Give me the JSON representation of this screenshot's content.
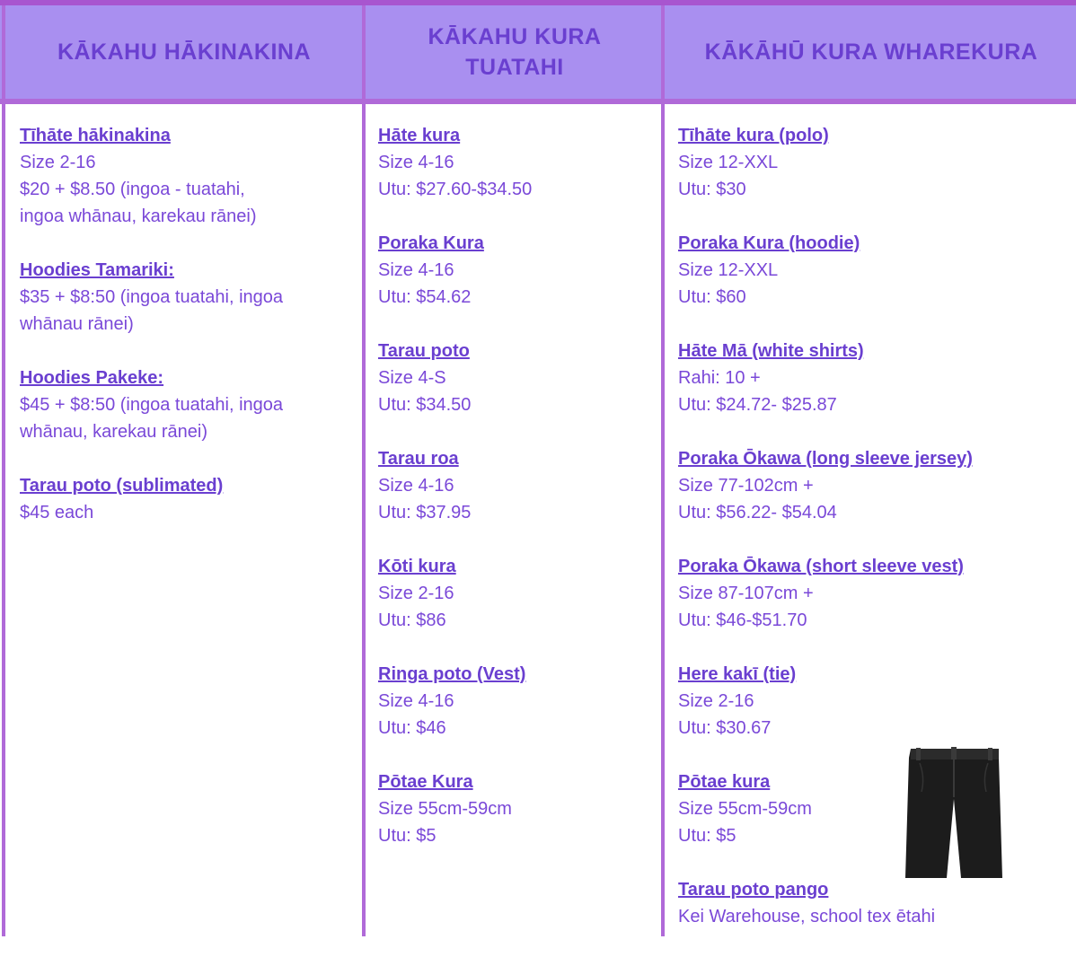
{
  "headers": [
    "KĀKAHU HĀKINAKINA",
    "KĀKAHU KURA TUATAHI",
    "KĀKĀHŪ KURA WHAREKURA"
  ],
  "columns": [
    {
      "items": [
        {
          "title": "Tīhāte hākinakina",
          "lines": [
            "Size 2-16",
            "$20 + $8.50 (ingoa - tuatahi,",
            "ingoa whānau, karekau rānei)"
          ]
        },
        {
          "title": "Hoodies Tamariki:",
          "lines": [
            "$35 + $8:50 (ingoa tuatahi, ingoa",
            "whānau rānei)"
          ]
        },
        {
          "title": "Hoodies Pakeke:",
          "lines": [
            "$45 + $8:50 (ingoa tuatahi, ingoa",
            "whānau, karekau rānei)"
          ]
        },
        {
          "title": "Tarau poto (sublimated)",
          "lines": [
            "$45 each"
          ]
        }
      ]
    },
    {
      "items": [
        {
          "title": "Hāte kura",
          "lines": [
            "Size 4-16",
            "Utu: $27.60-$34.50"
          ]
        },
        {
          "title": "Poraka Kura",
          "lines": [
            "Size 4-16",
            "Utu: $54.62"
          ]
        },
        {
          "title": "Tarau poto",
          "lines": [
            "Size 4-S",
            "Utu: $34.50"
          ]
        },
        {
          "title": "Tarau roa",
          "lines": [
            "Size 4-16",
            "Utu: $37.95"
          ]
        },
        {
          "title": "Kōti kura",
          "lines": [
            "Size 2-16",
            "Utu: $86"
          ]
        },
        {
          "title": "Ringa poto (Vest)",
          "lines": [
            "Size 4-16",
            "Utu: $46"
          ]
        },
        {
          "title": "Pōtae Kura",
          "lines": [
            "Size 55cm-59cm",
            "Utu: $5"
          ]
        }
      ]
    },
    {
      "items": [
        {
          "title": "Tīhāte kura (polo)",
          "lines": [
            "Size 12-XXL",
            "Utu: $30"
          ]
        },
        {
          "title": "Poraka Kura (hoodie)",
          "lines": [
            "Size 12-XXL",
            "Utu: $60"
          ]
        },
        {
          "title": "Hāte Mā (white shirts)",
          "lines": [
            "Rahi: 10 +",
            "Utu: $24.72- $25.87"
          ]
        },
        {
          "title": "Poraka Ōkawa (long sleeve jersey)",
          "lines": [
            "Size 77-102cm +",
            "Utu: $56.22- $54.04"
          ]
        },
        {
          "title": "Poraka Ōkawa (short sleeve vest)",
          "lines": [
            "Size 87-107cm +",
            "Utu: $46-$51.70"
          ]
        },
        {
          "title": "Here kakī (tie)",
          "lines": [
            "Size 2-16",
            "Utu: $30.67"
          ]
        },
        {
          "title": "Pōtae kura",
          "lines": [
            "Size 55cm-59cm",
            "Utu: $5"
          ]
        },
        {
          "title": "Tarau poto pango",
          "lines": [
            "Kei Warehouse, school tex ētahi"
          ]
        }
      ]
    }
  ]
}
